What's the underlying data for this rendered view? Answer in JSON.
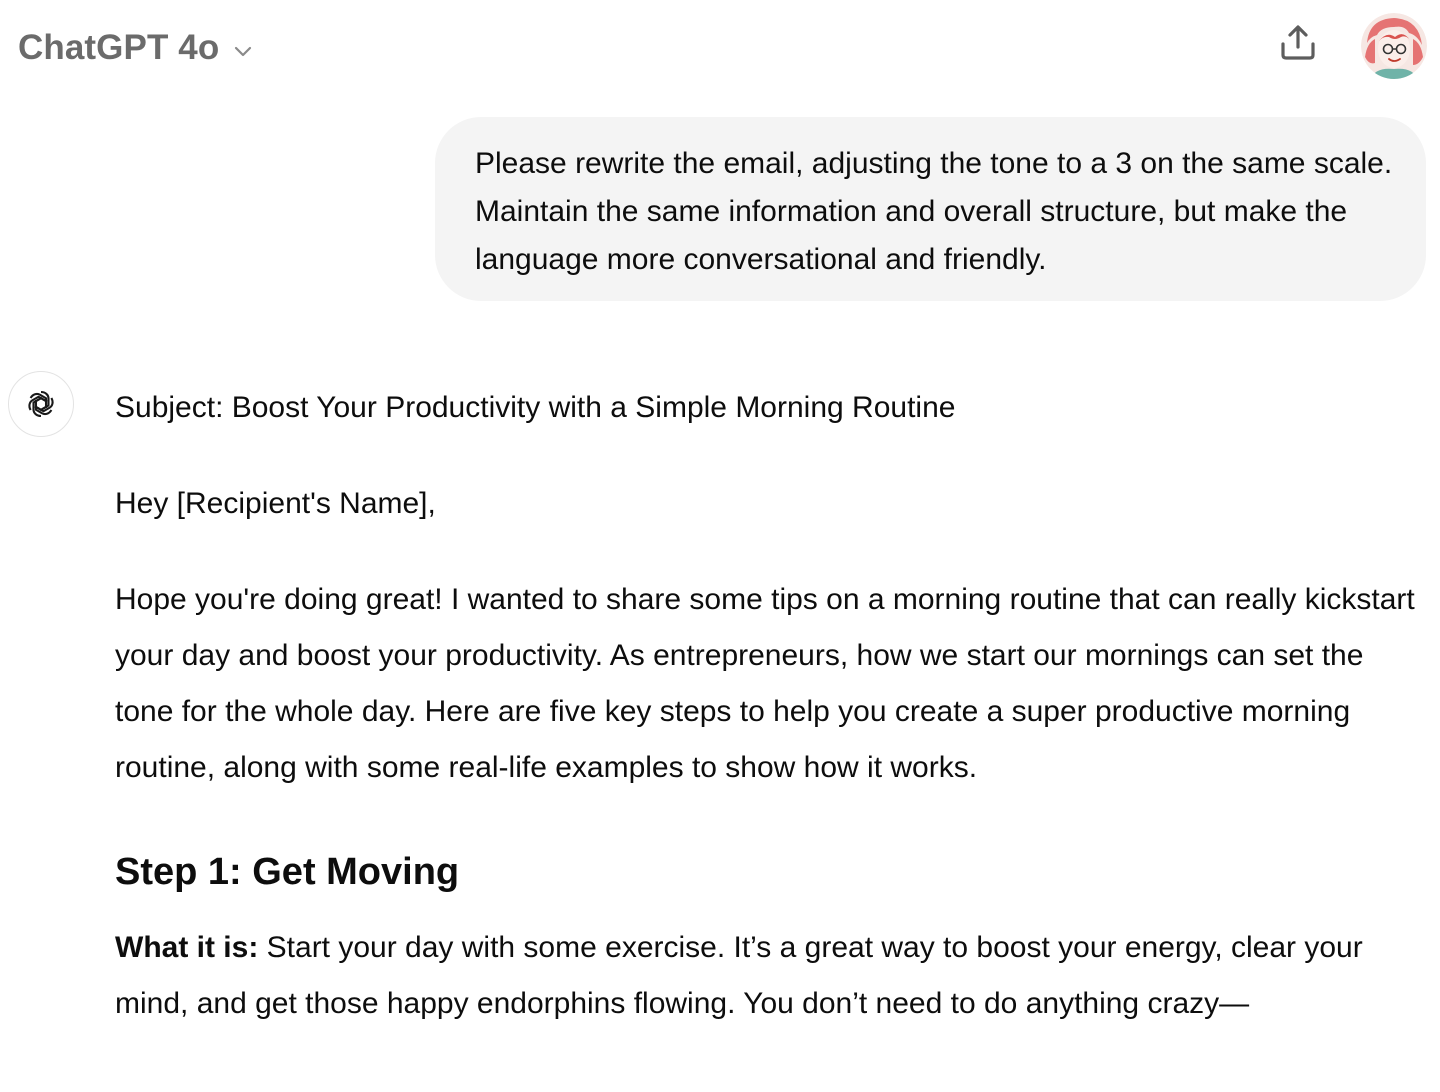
{
  "header": {
    "model_name": "ChatGPT 4o",
    "model_switcher_icon": "chevron-down-icon",
    "share_icon": "share-upload-icon",
    "avatar_icon": "user-avatar"
  },
  "conversation": {
    "user_message": "Please rewrite the email, adjusting the tone to a 3 on the same scale. Maintain the same information and overall structure, but make the language more conversational and friendly.",
    "assistant": {
      "icon": "openai-logo-icon",
      "subject": "Subject: Boost Your Productivity with a Simple Morning Routine",
      "greeting": "Hey [Recipient's Name],",
      "intro": "Hope you're doing great! I wanted to share some tips on a morning routine that can really kickstart your day and boost your productivity. As entrepreneurs, how we start our mornings can set the tone for the whole day. Here are five key steps to help you create a super productive morning routine, along with some real-life examples to show how it works.",
      "step1_heading": "Step 1: Get Moving",
      "step1_label": "What it is:",
      "step1_text": " Start your day with some exercise. It’s a great way to boost your energy, clear your mind, and get those happy endorphins flowing. You don’t need to do anything crazy—"
    }
  },
  "colors": {
    "bubble_bg": "#f4f4f4",
    "text": "#0d0d0d",
    "muted": "#6b6b6b"
  }
}
